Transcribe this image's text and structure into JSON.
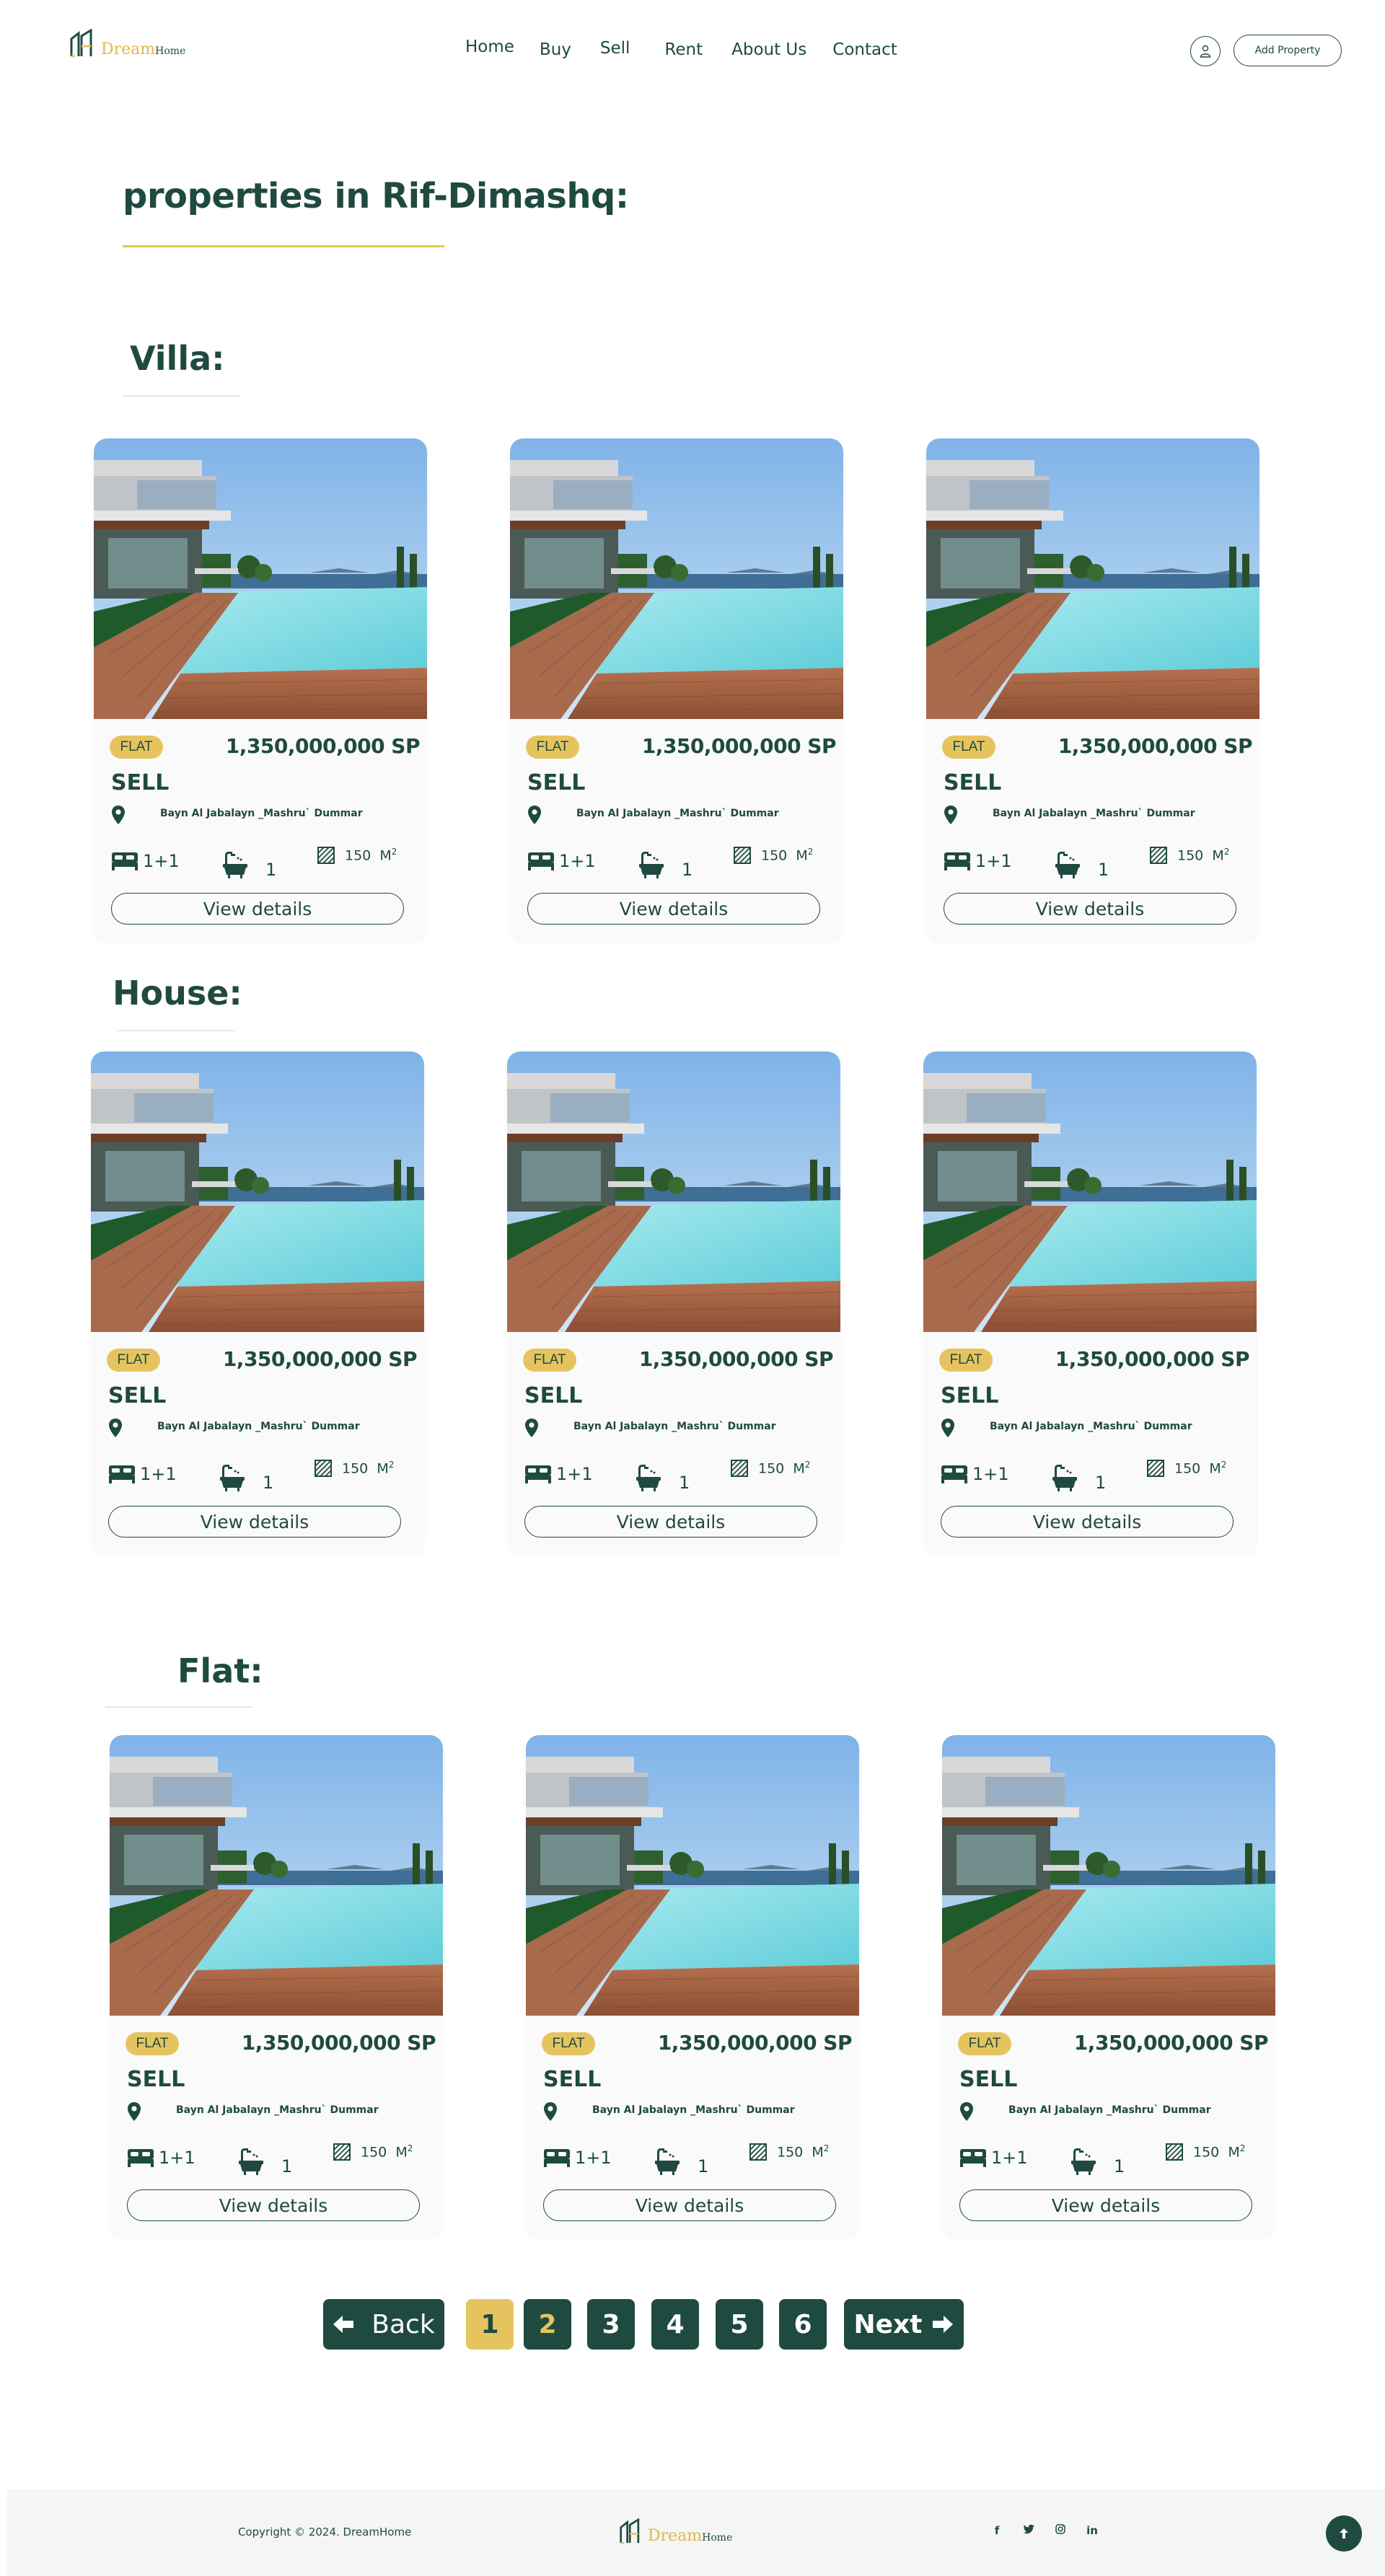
{
  "brand": {
    "name_part1": "Dream",
    "name_part2": "Home",
    "accent_color": "#e5c45f",
    "primary_color": "#1f4a40"
  },
  "nav": {
    "items": [
      "Home",
      "Buy",
      "Sell",
      "Rent",
      "About Us",
      "Contact"
    ]
  },
  "header": {
    "user_icon": "user-icon",
    "add_property_label": "Add Property"
  },
  "page": {
    "title": "properties in Rif-Dimashq:"
  },
  "sections": [
    {
      "heading": "Villa:"
    },
    {
      "heading": "House:"
    },
    {
      "heading": "Flat:"
    }
  ],
  "card": {
    "badge": "FLAT",
    "price": "1,350,000,000 SP",
    "deal": "SELL",
    "location": "Bayn Al Jabalayn _Mashru` Dummar",
    "bedrooms": "1+1",
    "bathrooms": "1",
    "area_value": "150",
    "area_unit": "M",
    "area_sup": "2",
    "view_label": "View details"
  },
  "pagination": {
    "back_label": "Back",
    "next_label": "Next",
    "pages": [
      "1",
      "2",
      "3",
      "4",
      "5",
      "6"
    ],
    "current": "1"
  },
  "footer": {
    "copyright": "Copyright © 2024. DreamHome",
    "socials": [
      "f",
      "t",
      "o",
      "in"
    ]
  }
}
